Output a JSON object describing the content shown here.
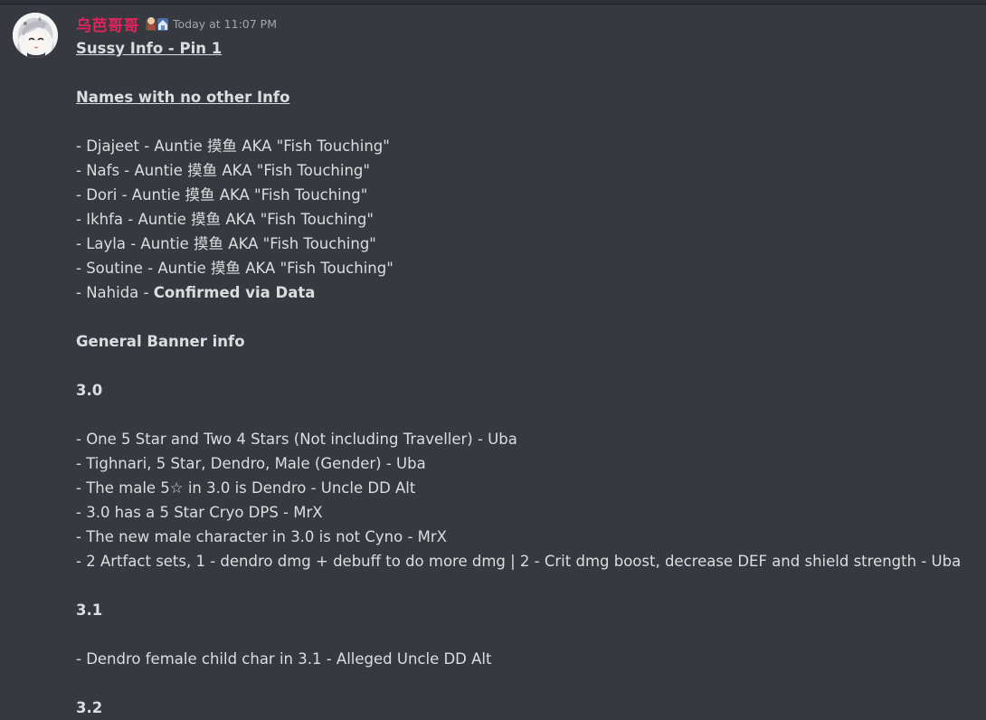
{
  "message": {
    "username": "乌芭哥哥",
    "username_color": "#e0245e",
    "role_icon": "role-badge-icon",
    "timestamp": "Today at 11:07 PM"
  },
  "lines": [
    "Sussy Info - Pin 1",
    "",
    "Names with no other Info",
    "",
    "- Djajeet - Auntie 摸鱼 AKA \"Fish Touching\"",
    "- Nafs - Auntie 摸鱼 AKA \"Fish Touching\"",
    "- Dori - Auntie 摸鱼 AKA \"Fish Touching\"",
    "- Ikhfa - Auntie 摸鱼 AKA \"Fish Touching\"",
    "- Layla - Auntie 摸鱼 AKA \"Fish Touching\"",
    "- Soutine - Auntie 摸鱼 AKA \"Fish Touching\"",
    "- Nahida - ",
    "",
    "General Banner info",
    "",
    "3.0",
    "",
    "- One 5 Star and Two 4 Stars (Not including Traveller) - Uba",
    "- Tighnari, 5 Star, Dendro, Male (Gender) - Uba",
    "- The male 5☆ in 3.0 is Dendro - Uncle DD Alt",
    "- 3.0 has a 5 Star Cryo DPS - MrX",
    "- The new male character in 3.0 is not Cyno - MrX",
    "- 2 Artfact sets, 1 - dendro dmg + debuff to do more dmg | 2 - Crit dmg boost, decrease DEF and shield strength - Uba",
    "",
    "3.1",
    "",
    "- Dendro female child char in 3.1 - Alleged Uncle DD Alt",
    "",
    "3.2"
  ],
  "nahida_emphasis": "Confirmed via Data"
}
